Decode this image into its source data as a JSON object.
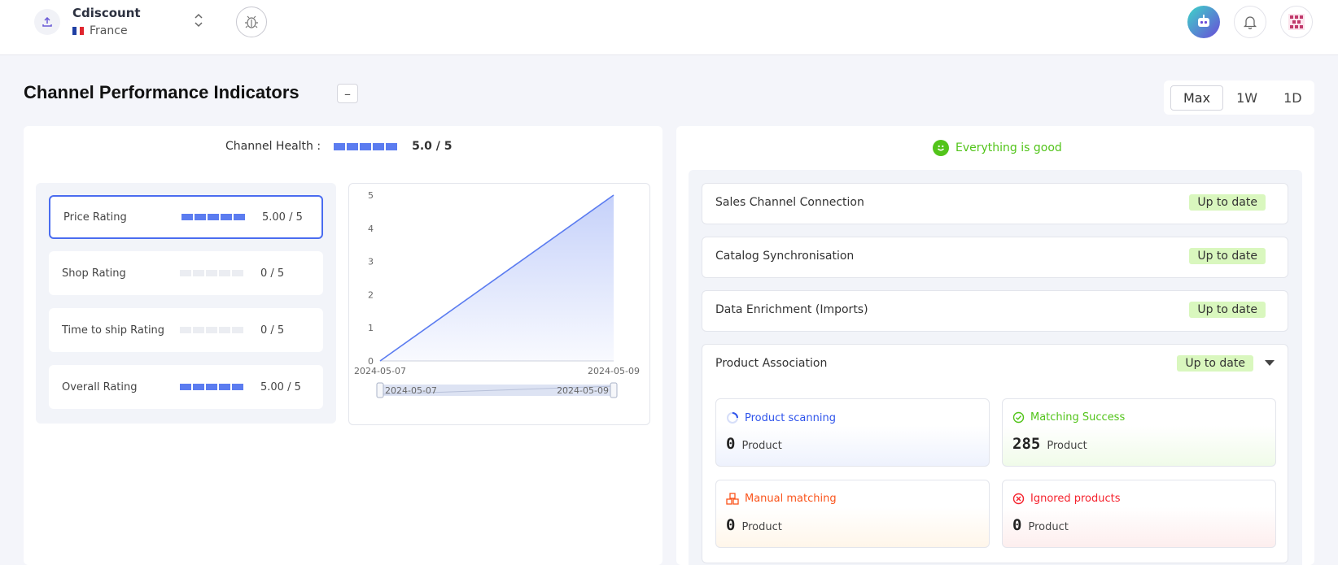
{
  "header": {
    "shop_name": "Cdiscount",
    "country": "France",
    "icons": [
      "upload-icon",
      "chevron-updown-icon",
      "bug-icon",
      "robot-icon",
      "bell-icon",
      "avatar-icon"
    ]
  },
  "page": {
    "title": "Channel Performance Indicators",
    "collapse_label": "–",
    "ranges": [
      "Max",
      "1W",
      "1D"
    ],
    "active_range": "Max"
  },
  "health": {
    "label": "Channel Health :",
    "value": "5.0 / 5",
    "level": 5
  },
  "ratings": [
    {
      "label": "Price Rating",
      "value": "5.00 / 5",
      "level": 5
    },
    {
      "label": "Shop Rating",
      "value": "0 / 5",
      "level": 0
    },
    {
      "label": "Time to ship Rating",
      "value": "0 / 5",
      "level": 0
    },
    {
      "label": "Overall Rating",
      "value": "5.00 / 5",
      "level": 5
    }
  ],
  "chart_data": {
    "type": "area",
    "x": [
      "2024-05-07",
      "2024-05-09"
    ],
    "y": [
      0,
      5
    ],
    "ylim": [
      0,
      5
    ],
    "yticks": [
      "0",
      "1",
      "2",
      "3",
      "4",
      "5"
    ],
    "xticks": [
      "2024-05-07",
      "2024-05-09"
    ],
    "zoom_labels": [
      "2024-05-07",
      "2024-05-09"
    ],
    "color": "#5b7cf0",
    "title": "",
    "xlabel": "",
    "ylabel": ""
  },
  "status": {
    "summary": "Everything is good",
    "items": [
      {
        "label": "Sales Channel Connection",
        "badge": "Up to date"
      },
      {
        "label": "Catalog Synchronisation",
        "badge": "Up to date"
      },
      {
        "label": "Data Enrichment (Imports)",
        "badge": "Up to date"
      },
      {
        "label": "Product Association",
        "badge": "Up to date"
      }
    ]
  },
  "metrics": {
    "scanning": {
      "title": "Product scanning",
      "count": "0",
      "unit": "Product"
    },
    "matching": {
      "title": "Matching Success",
      "count": "285",
      "unit": "Product"
    },
    "manual": {
      "title": "Manual matching",
      "count": "0",
      "unit": "Product"
    },
    "ignored": {
      "title": "Ignored products",
      "count": "0",
      "unit": "Product"
    }
  },
  "colors": {
    "accent": "#5b7cf0",
    "success": "#52c41a",
    "badge_bg": "#d9f7be",
    "warning": "#fa541c",
    "danger": "#f5222d"
  }
}
